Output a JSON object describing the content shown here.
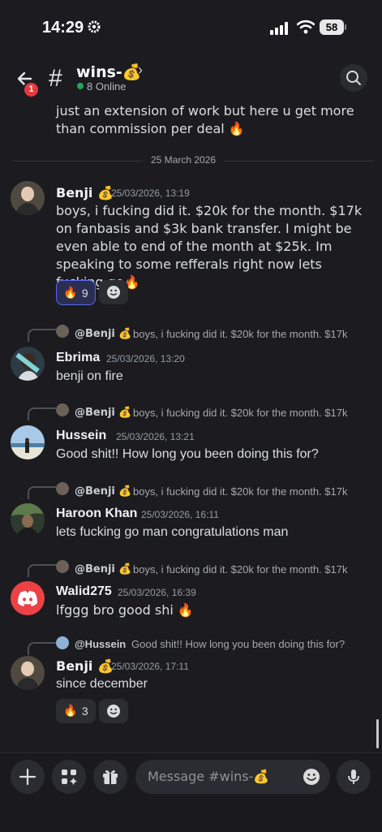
{
  "status_bar": {
    "time": "14:29",
    "battery": "58"
  },
  "header": {
    "badge_count": "1",
    "channel_name": "wins-💰",
    "chevron": "›",
    "online": "8 Online"
  },
  "previous_message": {
    "text": "just an extension of work but here u get more than commission per deal 🔥"
  },
  "date_divider": "25 March 2026",
  "messages": [
    {
      "author": "Benji 💰",
      "timestamp": "25/03/2026, 13:19",
      "text": "boys, i fucking did it. $20k for the month. $17k on fanbasis and $3k bank transfer. I might be even able to end of the month at $25k. Im speaking to some refferals right now lets fucking go🔥",
      "reaction": {
        "emoji": "🔥",
        "count": "9"
      }
    },
    {
      "reply": {
        "name": "@Benji 💰",
        "text": "boys, i fucking did it. $20k for the month. $17k"
      },
      "author": "Ebrima",
      "timestamp": "25/03/2026, 13:20",
      "text": "benji on fire"
    },
    {
      "reply": {
        "name": "@Benji 💰",
        "text": "boys, i fucking did it. $20k for the month. $17k"
      },
      "author": "Hussein",
      "timestamp": "25/03/2026, 13:21",
      "text": "Good shit!! How long you been doing this for?"
    },
    {
      "reply": {
        "name": "@Benji 💰",
        "text": "boys, i fucking did it. $20k for the month. $17k"
      },
      "author": "Haroon Khan",
      "timestamp": "25/03/2026, 16:11",
      "text": "lets fucking go man congratulations man"
    },
    {
      "reply": {
        "name": "@Benji 💰",
        "text": "boys, i fucking did it. $20k for the month. $17k"
      },
      "author": "Walid275",
      "timestamp": "25/03/2026, 16:39",
      "text": "lfggg bro good shi 🔥"
    },
    {
      "reply": {
        "name": "@Hussein",
        "text": "Good shit!! How long you been doing this for?"
      },
      "author": "Benji 💰",
      "timestamp": "25/03/2026, 17:11",
      "text": "since december",
      "reaction": {
        "emoji": "🔥",
        "count": "3"
      }
    }
  ],
  "composer": {
    "placeholder": "Message #wins-💰"
  },
  "colors": {
    "accent": "#5865f2",
    "online": "#23a55a",
    "badge": "#e5393c",
    "discord_red": "#ed4245"
  }
}
